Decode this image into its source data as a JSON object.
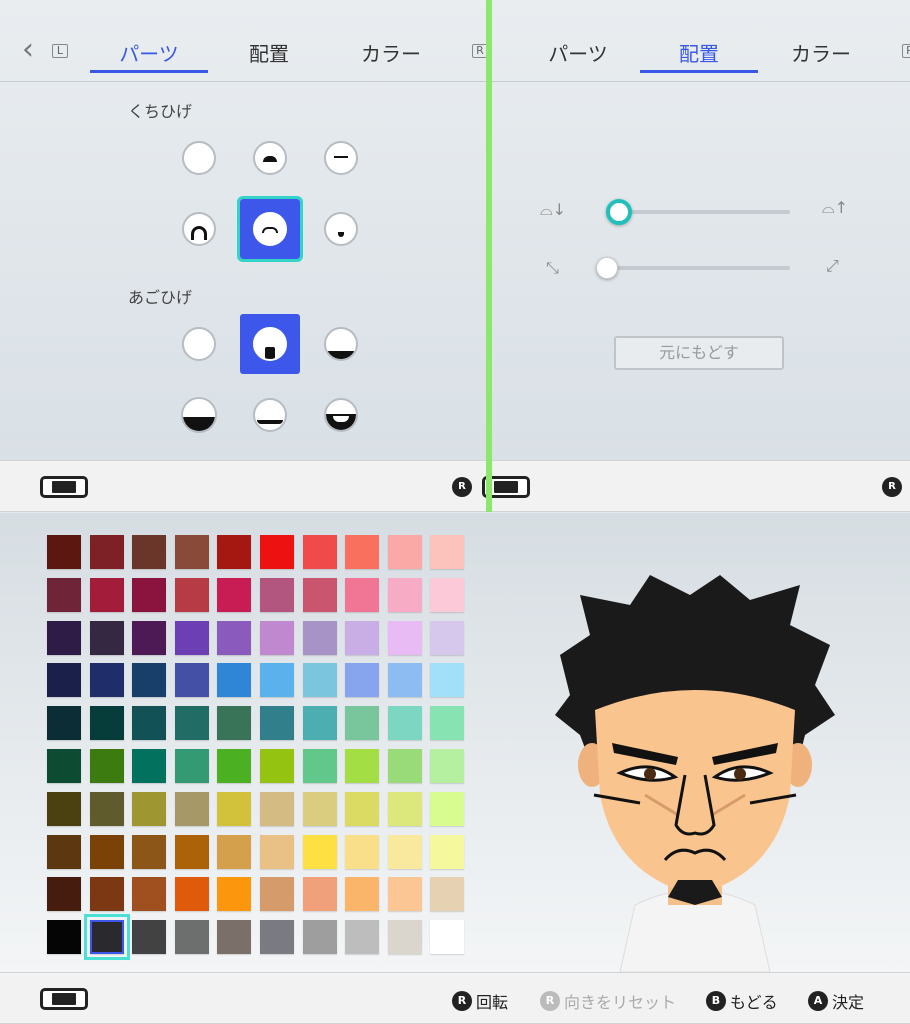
{
  "left_panel": {
    "tabs": [
      {
        "label": "パーツ",
        "active": true
      },
      {
        "label": "配置",
        "active": false
      },
      {
        "label": "カラー",
        "active": false
      }
    ],
    "btn_l": "L",
    "btn_r": "R",
    "mustache_label": "くちひげ",
    "beard_label": "あごひげ"
  },
  "right_panel": {
    "tabs": [
      {
        "label": "パーツ",
        "active": false
      },
      {
        "label": "配置",
        "active": true
      },
      {
        "label": "カラー",
        "active": false
      }
    ],
    "reset_label": "元にもどす",
    "sliders": [
      {
        "name": "vertical-position",
        "value": 0.0
      },
      {
        "name": "size",
        "value": 0.0
      }
    ]
  },
  "palette": {
    "colors": [
      [
        "#5b1710",
        "#7d2126",
        "#6a3629",
        "#8a4a3a",
        "#a51812",
        "#ee1111",
        "#f04a4a",
        "#f9705f",
        "#fba9a6",
        "#fbc3bb"
      ],
      [
        "#6f2537",
        "#a31c39",
        "#8a143e",
        "#b63b44",
        "#c81c54",
        "#b25680",
        "#c9566e",
        "#f17696",
        "#f8abc5",
        "#fbc9d7"
      ],
      [
        "#2e1c46",
        "#352842",
        "#4e1a55",
        "#6d3fb5",
        "#8a5bbd",
        "#c088cf",
        "#a893c7",
        "#c9aee6",
        "#e9bbf4",
        "#d6c7ec"
      ],
      [
        "#1a2049",
        "#1f2e6a",
        "#173f6a",
        "#4350a6",
        "#2f86d6",
        "#5bb1ec",
        "#7cc5de",
        "#87a4ef",
        "#8dbcf2",
        "#a1e0f8"
      ],
      [
        "#0d2d36",
        "#063c3a",
        "#125256",
        "#226c66",
        "#397458",
        "#317f8a",
        "#4caeb0",
        "#79c69c",
        "#7dd6c2",
        "#87e4b2"
      ],
      [
        "#0d4b33",
        "#3c7b10",
        "#02725f",
        "#339a73",
        "#4bb122",
        "#94c312",
        "#62c78b",
        "#a3de44",
        "#99da79",
        "#b5f0a0"
      ],
      [
        "#4a4010",
        "#605b2c",
        "#9e9630",
        "#a69867",
        "#d1c13b",
        "#d4bb84",
        "#dbcd7f",
        "#dbdb63",
        "#dce77c",
        "#d8fc8f"
      ],
      [
        "#5c3710",
        "#7a4206",
        "#8b5618",
        "#ac6208",
        "#d4a04c",
        "#e9c186",
        "#ffe042",
        "#fadf8b",
        "#f9e99e",
        "#f6f89d"
      ],
      [
        "#451c0e",
        "#7c3813",
        "#a0501f",
        "#e05a0c",
        "#fc960d",
        "#d59b6a",
        "#f0a07a",
        "#fbb56b",
        "#fcc694",
        "#e6d1b3"
      ],
      [
        "#050505",
        "#2a2a2e",
        "#424242",
        "#6d6e6e",
        "#7b6f69",
        "#7a7a82",
        "#9e9e9e",
        "#bdbdbd",
        "#dad6ce",
        "#ffffff"
      ]
    ],
    "selected_row": 9,
    "selected_col": 1
  },
  "footer": {
    "rotate_label": "回転",
    "reset_orientation_label": "向きをリセット",
    "back_label": "もどる",
    "confirm_label": "決定",
    "btn_b": "B",
    "btn_a": "A",
    "btn_r": "R"
  },
  "icons": {
    "back": "chevron-left-icon",
    "console": "console-icon",
    "rstick": "right-stick-icon"
  }
}
